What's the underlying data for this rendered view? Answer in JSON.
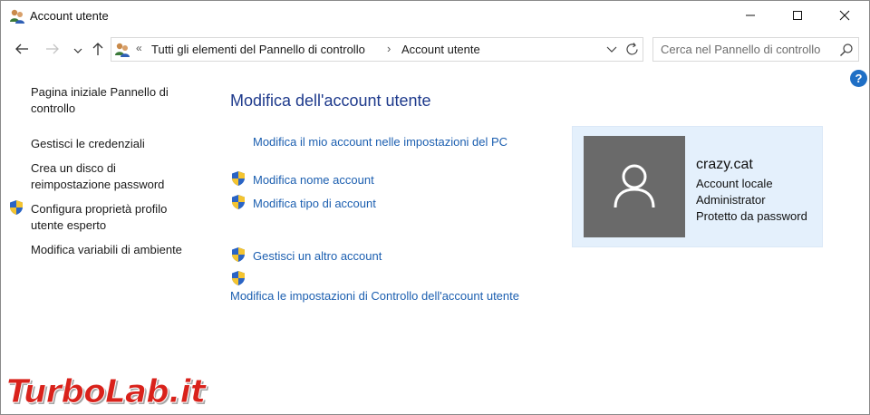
{
  "window": {
    "title": "Account utente",
    "controls": {
      "minimize_icon": "minimize-icon",
      "maximize_icon": "maximize-icon",
      "close_icon": "close-icon"
    }
  },
  "navigation": {
    "back_icon": "back-arrow-icon",
    "forward_icon": "forward-arrow-icon",
    "recent_icon": "chevron-down-icon",
    "up_icon": "up-arrow-icon"
  },
  "address": {
    "overflow": "«",
    "breadcrumbs": [
      "Tutti gli elementi del Pannello di controllo",
      "Account utente"
    ],
    "separator": "›"
  },
  "search": {
    "placeholder": "Cerca nel Pannello di controllo",
    "value": ""
  },
  "help": {
    "label": "?"
  },
  "sidebar": {
    "items": [
      {
        "label": "Pagina iniziale Pannello di controllo",
        "shield": false
      },
      {
        "label": "Gestisci le credenziali",
        "shield": false
      },
      {
        "label": "Crea un disco di reimpostazione password",
        "shield": false
      },
      {
        "label": "Configura proprietà profilo utente esperto",
        "shield": true
      },
      {
        "label": "Modifica variabili di ambiente",
        "shield": false
      }
    ]
  },
  "main": {
    "heading": "Modifica dell'account utente",
    "tasks": [
      {
        "label": "Modifica il mio account nelle impostazioni del PC",
        "shield": false
      },
      {
        "label": "Modifica nome account",
        "shield": true
      },
      {
        "label": "Modifica tipo di account",
        "shield": true
      },
      {
        "label": "Gestisci un altro account",
        "shield": true
      },
      {
        "label": "Modifica le impostazioni di Controllo dell'account utente",
        "shield": true
      }
    ]
  },
  "account": {
    "name": "crazy.cat",
    "details": [
      "Account locale",
      "Administrator",
      "Protetto da password"
    ],
    "avatar_icon": "user-silhouette-icon"
  },
  "watermark": {
    "part1": "Turbo",
    "part2": "Lab.it"
  },
  "colors": {
    "link": "#1c5fb0",
    "heading": "#1e3a8c",
    "card_bg": "#e4f0fc",
    "avatar_bg": "#6a6a6a",
    "help_bg": "#1f6fc5",
    "watermark": "#d9221b"
  }
}
